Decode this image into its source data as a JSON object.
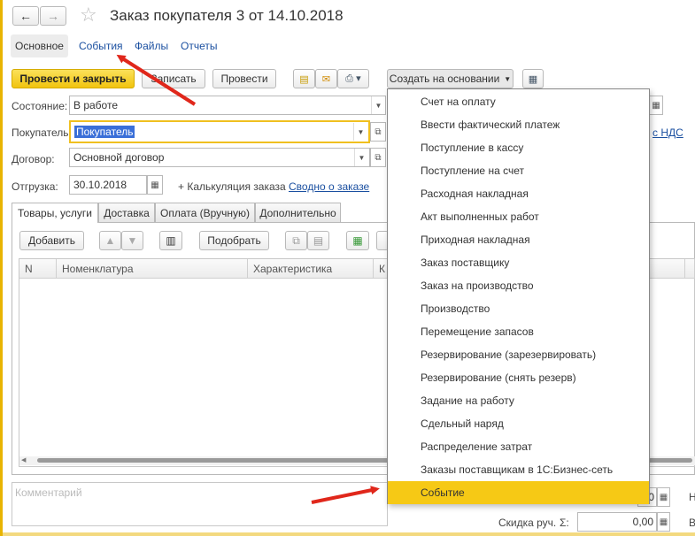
{
  "window": {
    "title": "Заказ покупателя 3 от 14.10.2018"
  },
  "nav_tabs": [
    {
      "label": "Основное"
    },
    {
      "label": "События"
    },
    {
      "label": "Файлы"
    },
    {
      "label": "Отчеты"
    }
  ],
  "toolbar": {
    "post_close": "Провести и закрыть",
    "write": "Записать",
    "post": "Провести",
    "create_based": "Создать на основании"
  },
  "form": {
    "state_label": "Состояние:",
    "state_value": "В работе",
    "buyer_label": "Покупатель:",
    "buyer_value": "Покупатель",
    "contract_label": "Договор:",
    "contract_value": "Основной договор",
    "shipment_label": "Отгрузка:",
    "shipment_value": "30.10.2018",
    "calc_link": "+ Калькуляция заказа",
    "summary_link": "Сводно о заказе",
    "vat_link": "с НДС"
  },
  "content_tabs": [
    {
      "label": "Товары, услуги"
    },
    {
      "label": "Доставка"
    },
    {
      "label": "Оплата (Вручную)"
    },
    {
      "label": "Дополнительно"
    }
  ],
  "table_toolbar": {
    "add": "Добавить",
    "pick": "Подобрать"
  },
  "table": {
    "columns": [
      "N",
      "Номенклатура",
      "Характеристика",
      "К"
    ]
  },
  "comment": {
    "placeholder": "Комментарий"
  },
  "footer": {
    "discount_label": "Скидка руч.",
    "sigma": "Σ:",
    "discount_value": "0,00",
    "value_top": "0",
    "right_letter_top": "Н",
    "right_letter_bottom": "В"
  },
  "create_menu": {
    "items": [
      "Счет на оплату",
      "Ввести фактический платеж",
      "Поступление в кассу",
      "Поступление на счет",
      "Расходная накладная",
      "Акт выполненных работ",
      "Приходная накладная",
      "Заказ поставщику",
      "Заказ на производство",
      "Производство",
      "Перемещение запасов",
      "Резервирование (зарезервировать)",
      "Резервирование (снять резерв)",
      "Задание на работу",
      "Сдельный наряд",
      "Распределение затрат",
      "Заказы поставщикам в 1С:Бизнес-сеть",
      "Событие"
    ],
    "highlighted_index": 17
  },
  "colors": {
    "accent_yellow": "#f6c915",
    "link_blue": "#1a4fa0",
    "arrow_red": "#e0271b",
    "left_border": "#e8b400"
  }
}
